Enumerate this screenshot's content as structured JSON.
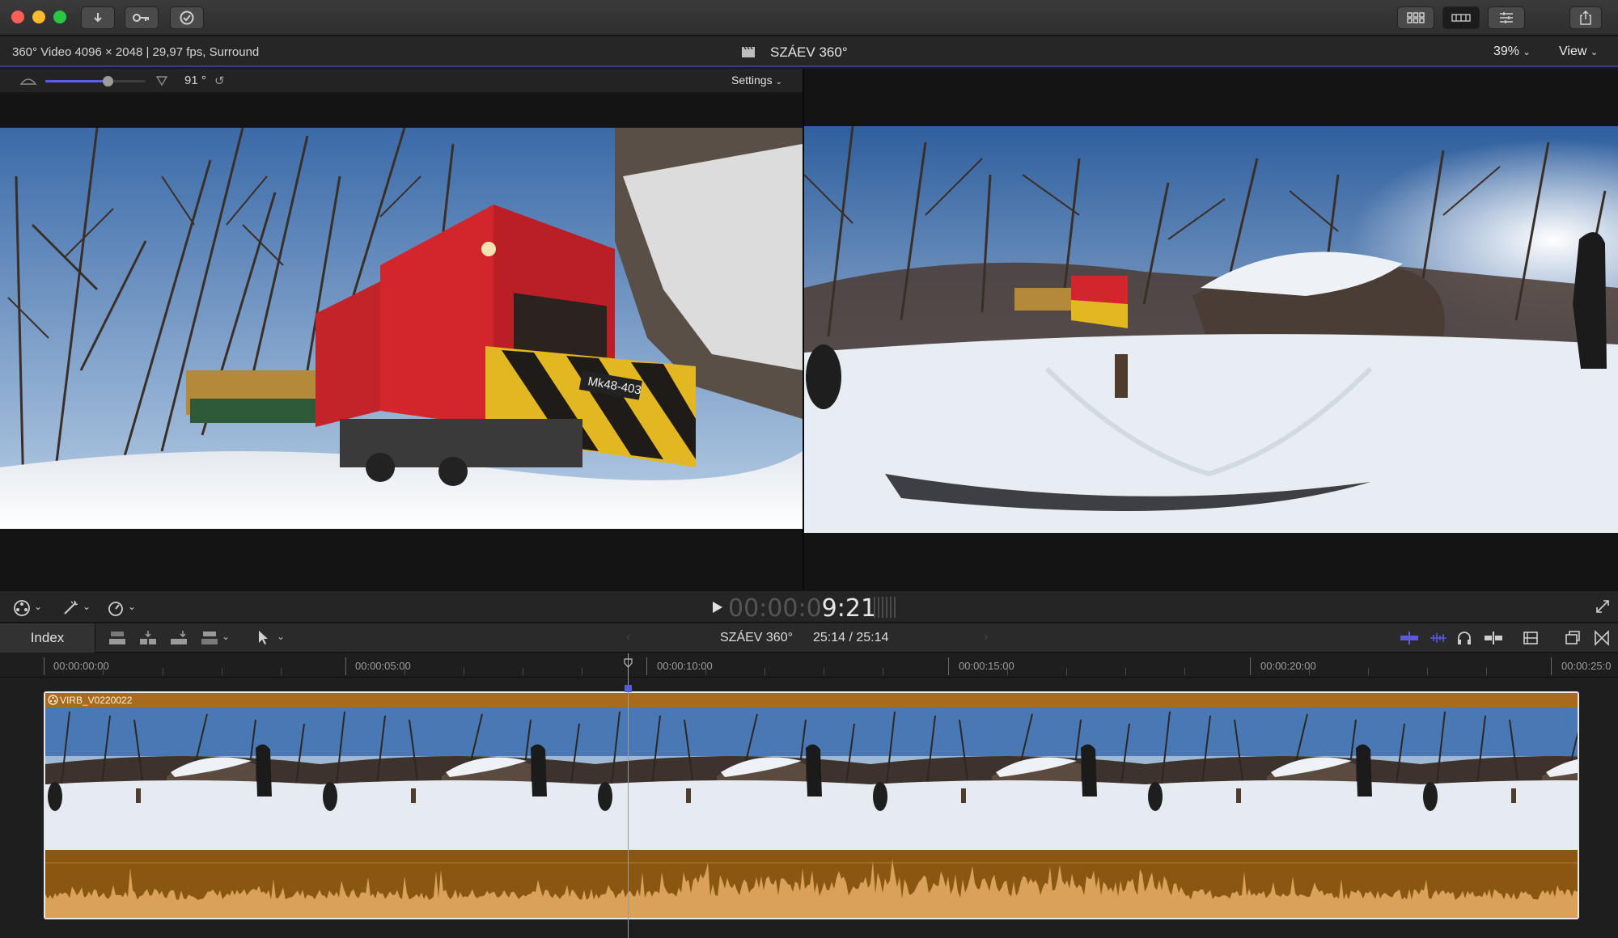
{
  "window": {
    "title_bar_buttons": [
      "import-icon",
      "keywords-icon",
      "background-tasks-icon"
    ],
    "right_buttons": [
      "browser-toggle-icon",
      "timeline-toggle-icon",
      "inspector-toggle-icon",
      "share-icon"
    ]
  },
  "info_bar": {
    "format": "360° Video 4096 × 2048 | 29,97 fps, Surround",
    "project_title": "SZÁEV 360°",
    "zoom": "39%",
    "view_label": "View"
  },
  "viewer_controls": {
    "field_of_view": "91 °",
    "fov_fraction": 0.62,
    "settings_label": "Settings"
  },
  "transport": {
    "timecode_dim": "00:00:0",
    "timecode_bright": "9:21"
  },
  "timeline_toolbar": {
    "index_label": "Index",
    "project_name": "SZÁEV 360°",
    "duration": "25:14 / 25:14"
  },
  "ruler": {
    "labels": [
      "00:00:00:00",
      "00:00:05:00",
      "00:00:10:00",
      "00:00:15:00",
      "00:00:20:00",
      "00:00:25:0"
    ]
  },
  "clip": {
    "name": "VIRB_V0220022"
  },
  "colors": {
    "accent": "#5a5ae0",
    "clip_orange": "#a86a1c",
    "audio_wave": "#d9a15a"
  }
}
